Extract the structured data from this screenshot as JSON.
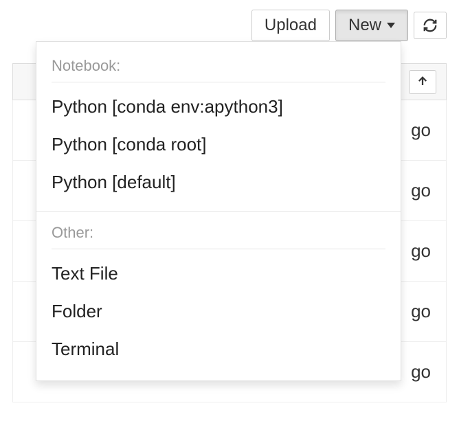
{
  "toolbar": {
    "upload_label": "Upload",
    "new_label": "New"
  },
  "dropdown": {
    "section_notebook_label": "Notebook:",
    "notebook_items": [
      "Python [conda env:apython3]",
      "Python [conda root]",
      "Python [default]"
    ],
    "section_other_label": "Other:",
    "other_items": [
      "Text File",
      "Folder",
      "Terminal"
    ]
  },
  "background_rows": [
    "go",
    "go",
    "go",
    "go",
    "go"
  ]
}
